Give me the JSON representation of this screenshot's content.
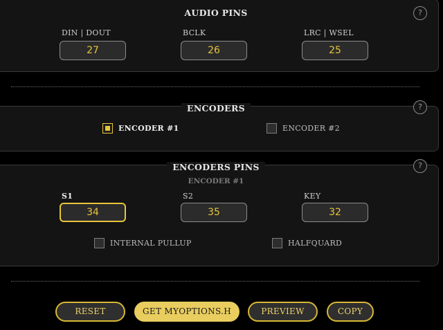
{
  "audio": {
    "title": "AUDIO PINS",
    "help": "?",
    "fields": [
      {
        "label": "DIN | DOUT",
        "value": "27"
      },
      {
        "label": "BCLK",
        "value": "26"
      },
      {
        "label": "LRC | WSEL",
        "value": "25"
      }
    ]
  },
  "encoders": {
    "title": "ENCODERS",
    "help": "?",
    "options": [
      {
        "label": "ENCODER #1",
        "checked": true
      },
      {
        "label": "ENCODER #2",
        "checked": false
      }
    ]
  },
  "encoder_pins": {
    "title": "ENCODERS PINS",
    "help": "?",
    "subtitle": "ENCODER #1",
    "fields": [
      {
        "label": "S1",
        "value": "34"
      },
      {
        "label": "S2",
        "value": "35"
      },
      {
        "label": "KEY",
        "value": "32"
      }
    ],
    "options": [
      {
        "label": "INTERNAL PULLUP",
        "checked": false
      },
      {
        "label": "HALFQUARD",
        "checked": false
      }
    ]
  },
  "buttons": {
    "reset": "RESET",
    "get": "GET MYOPTIONS.H",
    "preview": "PREVIEW",
    "copy": "COPY"
  },
  "colors": {
    "accent": "#e8c53a",
    "background": "#000000",
    "panel": "#141414"
  }
}
